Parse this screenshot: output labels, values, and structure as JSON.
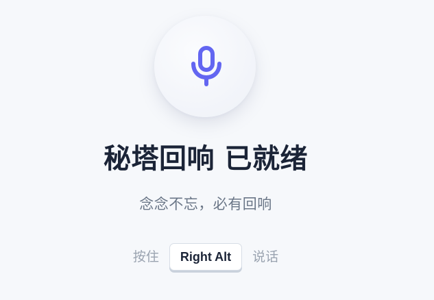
{
  "status": {
    "title": "秘塔回响 已就绪",
    "subtitle": "念念不忘，必有回响"
  },
  "hotkey": {
    "prefix": "按住",
    "key": "Right Alt",
    "suffix": "说话"
  },
  "icons": {
    "mic": "microphone-icon"
  },
  "colors": {
    "accent": "#6366f1",
    "background": "#f6f8fb",
    "title": "#1b2437",
    "subtitle": "#6a7687",
    "hint": "#9aa3b0"
  }
}
